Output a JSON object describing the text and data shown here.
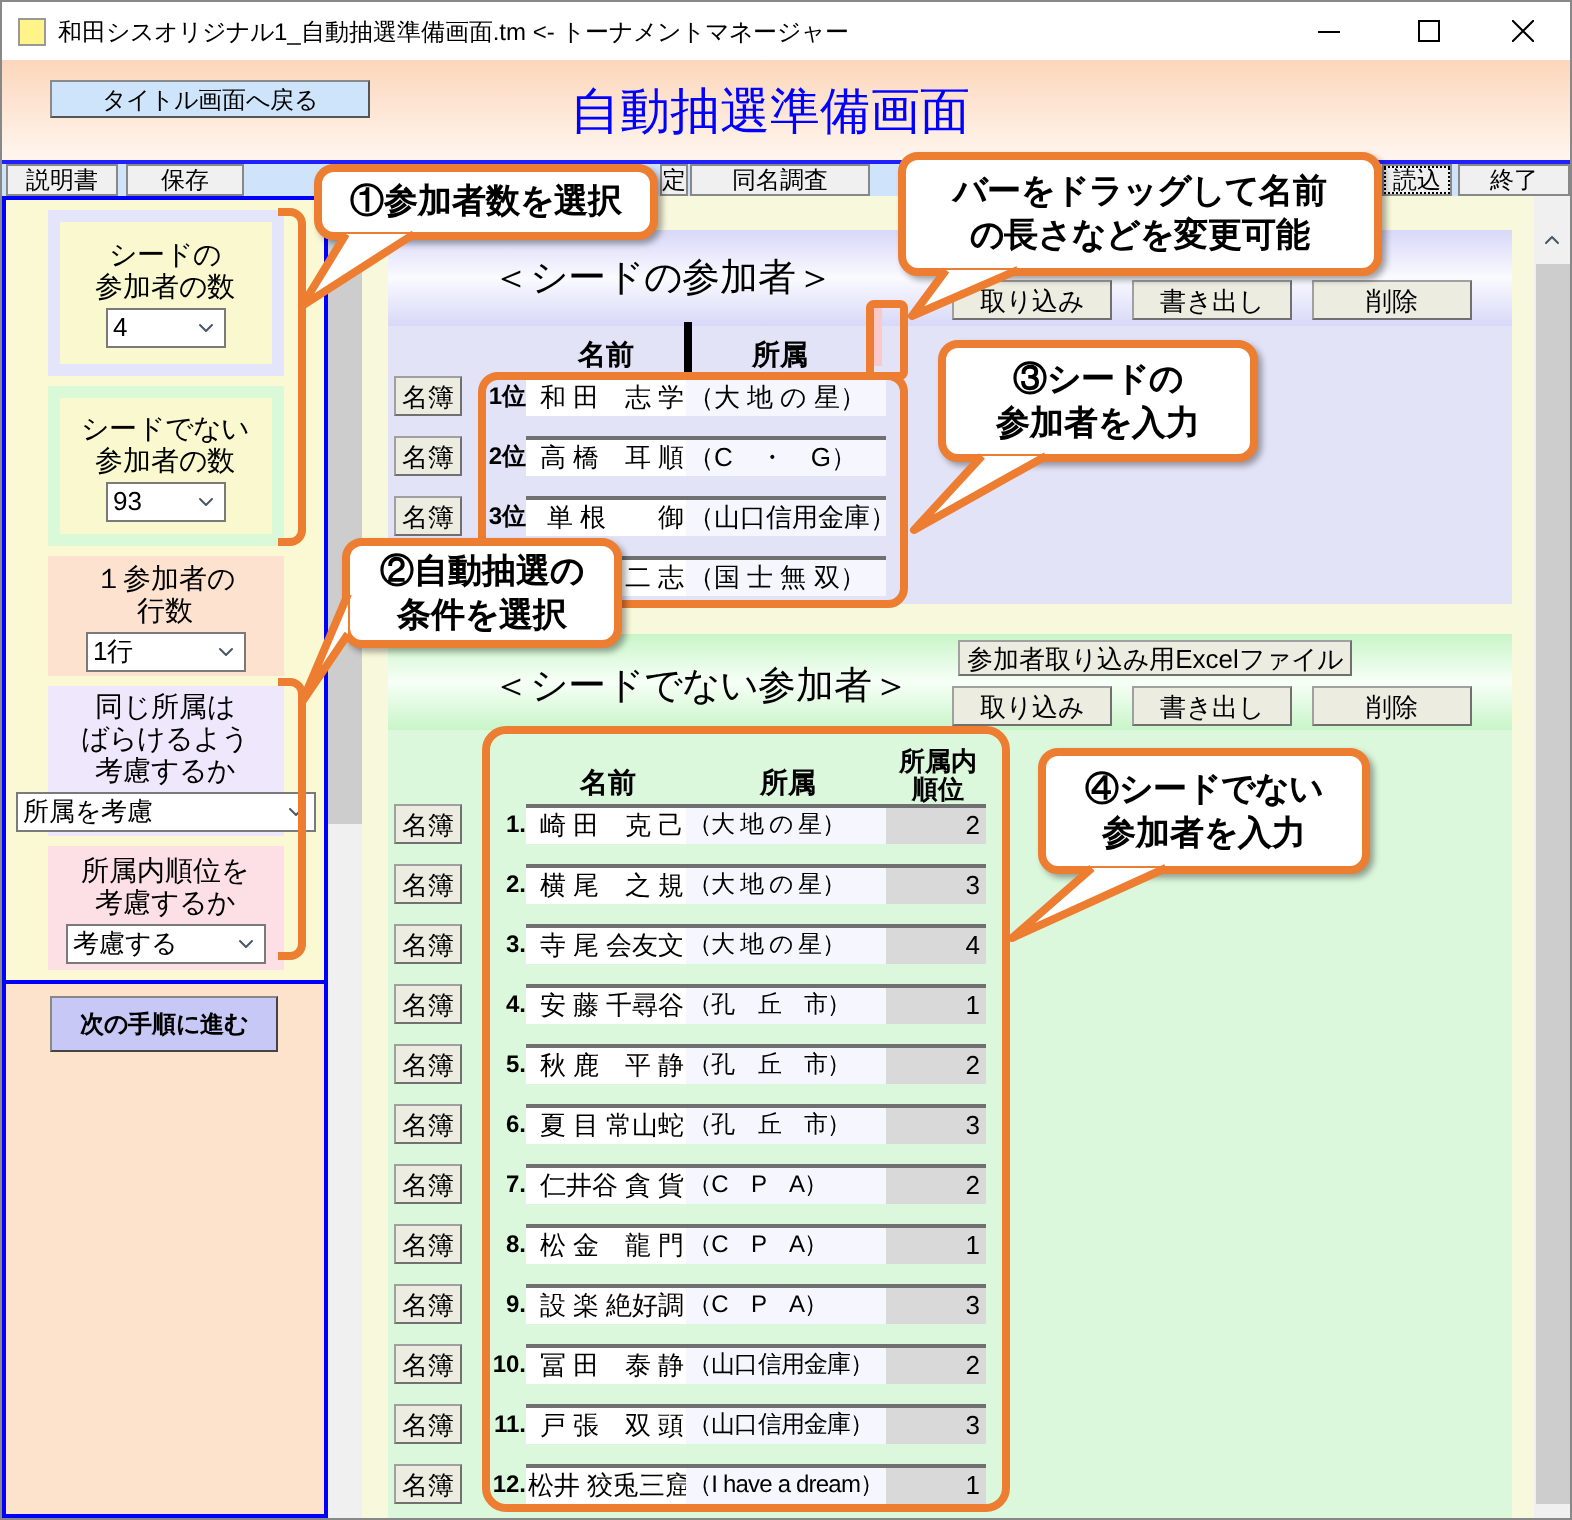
{
  "window": {
    "title": "和田シスオリジナル1_自動抽選準備画面.tm <- トーナメントマネージャー"
  },
  "header": {
    "back_button": "タイトル画面へ戻る",
    "title": "自動抽選準備画面"
  },
  "toolbar": [
    {
      "label": "説明書",
      "focused": false
    },
    {
      "label": "保存",
      "focused": false
    },
    {
      "label": "定",
      "focused": false
    },
    {
      "label": "同名調査",
      "focused": false
    },
    {
      "label": "読込",
      "focused": true
    },
    {
      "label": "終了",
      "focused": false
    }
  ],
  "settings": [
    {
      "kind": "seed",
      "lines": [
        "シードの",
        "参加者の数"
      ],
      "value": "4"
    },
    {
      "kind": "nonseed",
      "lines": [
        "シードでない",
        "参加者の数"
      ],
      "value": "93"
    },
    {
      "kind": "rows",
      "lines": [
        "１参加者の",
        "行数"
      ],
      "value": "1行"
    },
    {
      "kind": "spread",
      "lines": [
        "同じ所属は",
        "ばらけるよう",
        "考慮するか"
      ],
      "value": "所属を考慮"
    },
    {
      "kind": "rank",
      "lines": [
        "所属内順位を",
        "考慮するか"
      ],
      "value": "考慮する"
    }
  ],
  "next_button": "次の手順に進む",
  "seeded": {
    "title": "＜シードの参加者＞",
    "buttons": [
      "取り込み",
      "書き出し",
      "削除"
    ],
    "columns": [
      "名前",
      "所属"
    ],
    "rows": [
      {
        "roster": "名簿",
        "rank": "1位",
        "name": "和 田　志 学",
        "team": "（大 地 の 星）"
      },
      {
        "roster": "名簿",
        "rank": "2位",
        "name": "高 橋　耳 順",
        "team": "（C　・　G）"
      },
      {
        "roster": "名簿",
        "rank": "3位",
        "name": "単 根　　御",
        "team": "（山口信用金庫）"
      },
      {
        "name": "二 志",
        "team": "（国 士 無 双）"
      }
    ]
  },
  "unseeded": {
    "title": "＜シードでない参加者＞",
    "excel_button": "参加者取り込み用Excelファイル",
    "buttons": [
      "取り込み",
      "書き出し",
      "削除"
    ],
    "columns": [
      "名前",
      "所属"
    ],
    "order_column": [
      "所属内",
      "順位"
    ],
    "rows": [
      {
        "roster": "名簿",
        "number": "1.",
        "name": "崎 田　克 己",
        "team": "（大 地 の 星）",
        "order": "2"
      },
      {
        "roster": "名簿",
        "number": "2.",
        "name": "横 尾　之 規",
        "team": "（大 地 の 星）",
        "order": "3"
      },
      {
        "roster": "名簿",
        "number": "3.",
        "name": "寺 尾 会友文",
        "team": "（大 地 の 星）",
        "order": "4"
      },
      {
        "roster": "名簿",
        "number": "4.",
        "name": "安 藤 千尋谷",
        "team": "（孔　丘　市）",
        "order": "1"
      },
      {
        "roster": "名簿",
        "number": "5.",
        "name": "秋 鹿　平 静",
        "team": "（孔　丘　市）",
        "order": "2"
      },
      {
        "roster": "名簿",
        "number": "6.",
        "name": "夏 目 常山蛇",
        "team": "（孔　丘　市）",
        "order": "3"
      },
      {
        "roster": "名簿",
        "number": "7.",
        "name": "仁井谷 貪 貨",
        "team": "（C　P　A）",
        "order": "2"
      },
      {
        "roster": "名簿",
        "number": "8.",
        "name": "松 金　龍 門",
        "team": "（C　P　A）",
        "order": "1"
      },
      {
        "roster": "名簿",
        "number": "9.",
        "name": "設 楽 絶好調",
        "team": "（C　P　A）",
        "order": "3"
      },
      {
        "roster": "名簿",
        "number": "10.",
        "name": "冨 田　泰 静",
        "team": "（山口信用金庫）",
        "order": "2"
      },
      {
        "roster": "名簿",
        "number": "11.",
        "name": "戸 張　双 頭",
        "team": "（山口信用金庫）",
        "order": "3"
      },
      {
        "roster": "名簿",
        "number": "12.",
        "name": "松井 狡兎三窟",
        "team": "（I have a dream）",
        "order": "1"
      }
    ]
  },
  "callouts": [
    {
      "lines": [
        "①参加者数を選択"
      ]
    },
    {
      "lines": [
        "バーをドラッグして名前",
        "の長さなどを変更可能"
      ]
    },
    {
      "lines": [
        "③シードの",
        "参加者を入力"
      ]
    },
    {
      "lines": [
        "②自動抽選の",
        "条件を選択"
      ]
    },
    {
      "lines": [
        "④シードでない",
        "参加者を入力"
      ]
    }
  ]
}
